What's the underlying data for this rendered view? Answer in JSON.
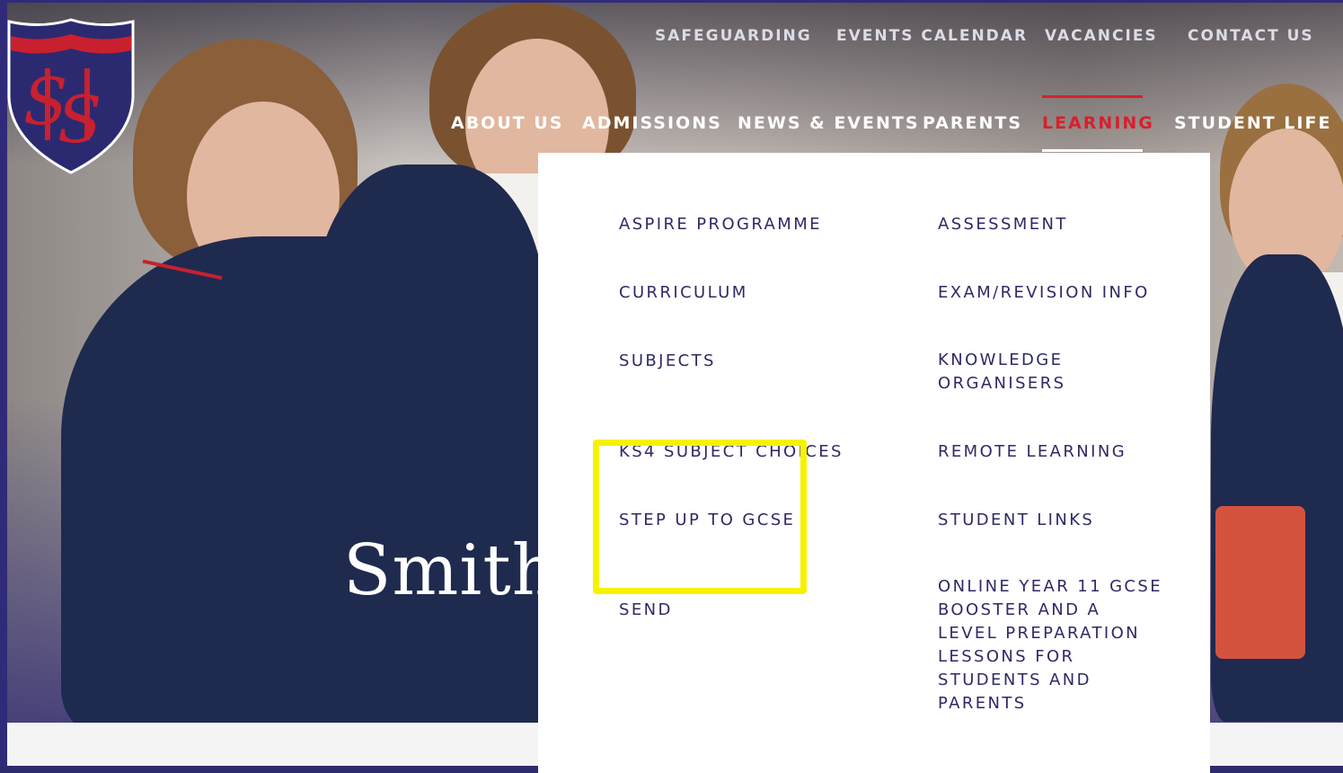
{
  "school": {
    "logo_letters": "SHS",
    "hero_title_visible": "Smithi"
  },
  "top_nav": [
    {
      "label": "SAFEGUARDING"
    },
    {
      "label": "EVENTS CALENDAR"
    },
    {
      "label": "VACANCIES"
    },
    {
      "label": "CONTACT US"
    }
  ],
  "main_nav": [
    {
      "label": "ABOUT US"
    },
    {
      "label": "ADMISSIONS"
    },
    {
      "label": "NEWS & EVENTS"
    },
    {
      "label": "PARENTS"
    },
    {
      "label": "LEARNING",
      "active": true
    },
    {
      "label": "STUDENT LIFE"
    }
  ],
  "learning_menu": {
    "left_column": [
      {
        "label": "ASPIRE PROGRAMME"
      },
      {
        "label": "CURRICULUM"
      },
      {
        "label": "SUBJECTS"
      },
      {
        "label": "KS4 SUBJECT CHOICES"
      },
      {
        "label": "STEP UP TO GCSE"
      },
      {
        "label": "SEND"
      }
    ],
    "right_column": [
      {
        "label": "ASSESSMENT"
      },
      {
        "label": "EXAM/REVISION INFO"
      },
      {
        "label": "KNOWLEDGE ORGANISERS"
      },
      {
        "label": "REMOTE LEARNING"
      },
      {
        "label": "STUDENT LINKS"
      },
      {
        "label": "ONLINE YEAR 11 GCSE BOOSTER AND A LEVEL PREPARATION LESSONS FOR STUDENTS AND PARENTS"
      }
    ]
  },
  "colors": {
    "navy": "#2e2a66",
    "accent_red": "#d8202c",
    "highlight_yellow": "#f6f200"
  }
}
